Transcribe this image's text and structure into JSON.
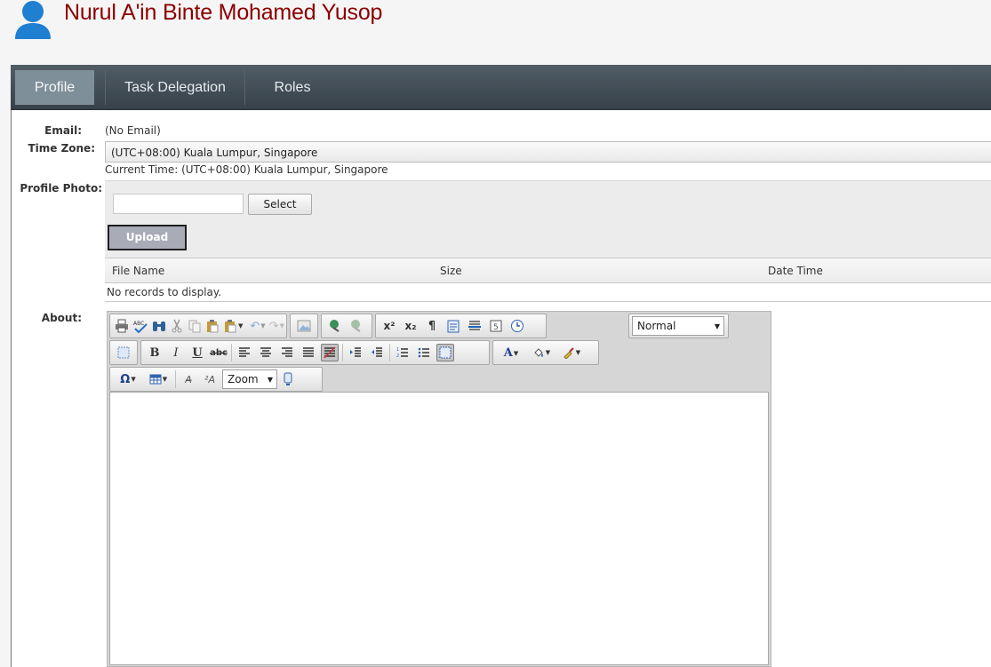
{
  "header": {
    "user_name": "Nurul A'in Binte Mohamed Yusop",
    "avatar_icon": "user-avatar-icon",
    "avatar_color": "#1f7fd1",
    "name_color": "#8b0000"
  },
  "nav": {
    "tabs": [
      {
        "label": "Profile",
        "active": true
      },
      {
        "label": "Task Delegation",
        "active": false
      },
      {
        "label": "Roles",
        "active": false
      }
    ]
  },
  "profile": {
    "email_label": "Email:",
    "email_value": "(No Email)",
    "timezone_label": "Time Zone:",
    "timezone_value": "(UTC+08:00) Kuala Lumpur, Singapore",
    "current_time": "Current Time: (UTC+08:00) Kuala Lumpur, Singapore",
    "photo_label": "Profile Photo:",
    "file_input_value": "",
    "select_button": "Select",
    "upload_button": "Upload",
    "files_table": {
      "columns": [
        "File Name",
        "Size",
        "Date Time"
      ],
      "empty_message": "No records to display."
    },
    "about_label": "About:"
  },
  "editor": {
    "format_select": "Normal",
    "zoom_select": "Zoom",
    "toolbar_icons": [
      "print-icon",
      "spellcheck-icon",
      "find-icon",
      "cut-icon",
      "copy-icon",
      "paste-icon",
      "paste-options-icon",
      "undo-icon",
      "redo-icon",
      "image-manager-icon",
      "hyperlink-icon",
      "remove-link-icon",
      "superscript-icon",
      "subscript-icon",
      "paragraph-icon",
      "insert-snippet-icon",
      "horizontal-rule-icon",
      "form-element-icon",
      "insert-date-icon",
      "select-all-icon",
      "bold-icon",
      "italic-icon",
      "underline-icon",
      "strikethrough-icon",
      "align-left-icon",
      "align-center-icon",
      "align-right-icon",
      "justify-icon",
      "justify-none-icon",
      "indent-icon",
      "outdent-icon",
      "numbered-list-icon",
      "bulleted-list-icon",
      "toggle-borders-icon",
      "foreground-color-icon",
      "background-color-icon",
      "format-stripper-icon",
      "symbol-icon",
      "table-icon",
      "apply-css-class-icon",
      "format-sets-icon",
      "module-manager-icon"
    ]
  }
}
